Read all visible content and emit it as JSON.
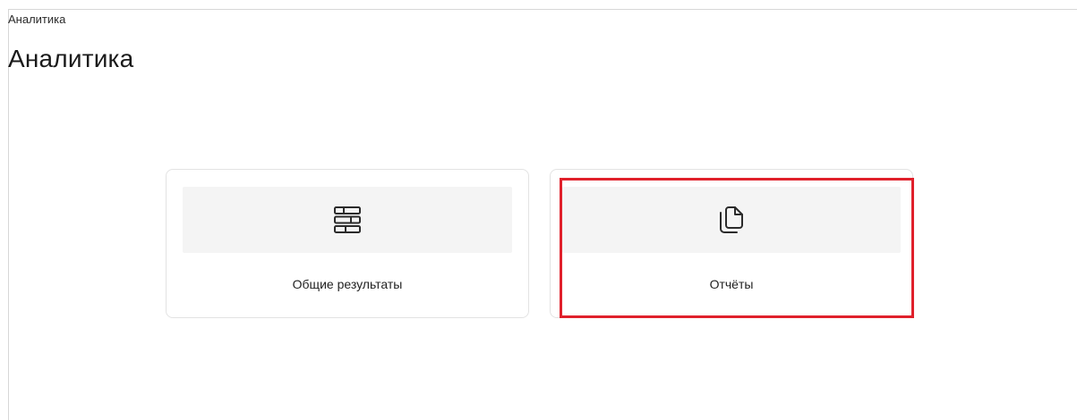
{
  "breadcrumb": {
    "current": "Аналитика"
  },
  "page": {
    "title": "Аналитика"
  },
  "cards": [
    {
      "label": "Общие результаты",
      "icon": "table-icon"
    },
    {
      "label": "Отчёты",
      "icon": "copy-document-icon"
    }
  ],
  "highlight": {
    "color": "#e0202b",
    "target": "Отчёты"
  }
}
